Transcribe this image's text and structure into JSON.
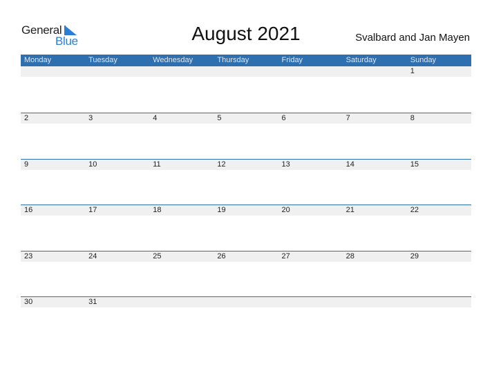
{
  "logo": {
    "general": "General",
    "blue": "Blue"
  },
  "title": "August 2021",
  "region": "Svalbard and Jan Mayen",
  "colors": {
    "accent": "#2e6fb0",
    "brand_blue": "#2a7fd4",
    "strip": "#f0f0f0"
  },
  "weekdays": [
    "Monday",
    "Tuesday",
    "Wednesday",
    "Thursday",
    "Friday",
    "Saturday",
    "Sunday"
  ],
  "weeks": [
    [
      "",
      "",
      "",
      "",
      "",
      "",
      "1"
    ],
    [
      "2",
      "3",
      "4",
      "5",
      "6",
      "7",
      "8"
    ],
    [
      "9",
      "10",
      "11",
      "12",
      "13",
      "14",
      "15"
    ],
    [
      "16",
      "17",
      "18",
      "19",
      "20",
      "21",
      "22"
    ],
    [
      "23",
      "24",
      "25",
      "26",
      "27",
      "28",
      "29"
    ],
    [
      "30",
      "31",
      "",
      "",
      "",
      "",
      ""
    ]
  ]
}
